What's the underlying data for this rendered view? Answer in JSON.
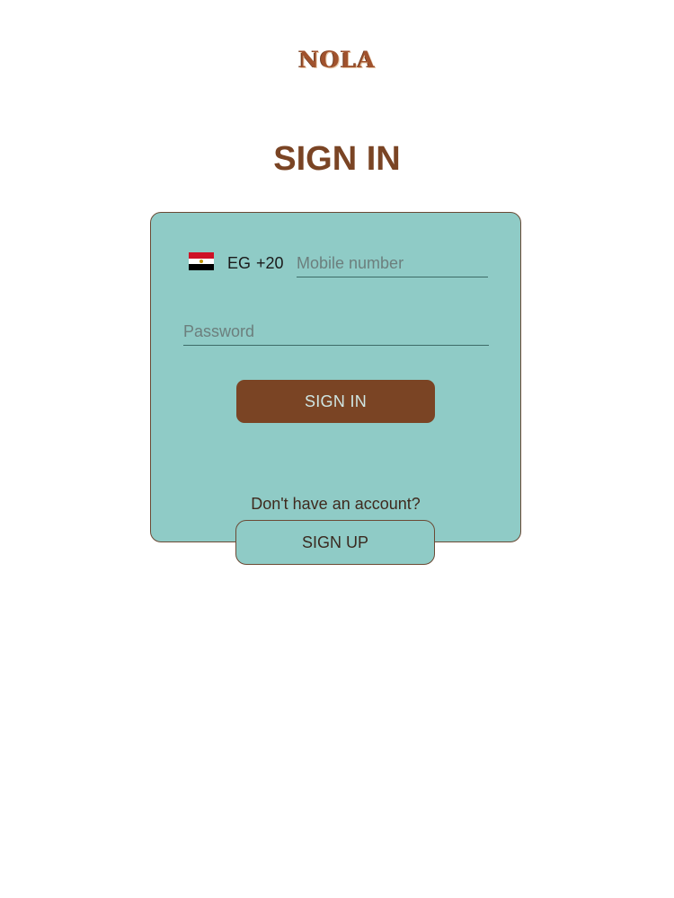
{
  "brand": {
    "logo_text": "NOLA"
  },
  "header": {
    "title": "SIGN IN"
  },
  "form": {
    "country": {
      "flag_icon": "egypt-flag-icon",
      "code": "EG",
      "dial_code": "+20"
    },
    "mobile": {
      "placeholder": "Mobile number",
      "value": ""
    },
    "password": {
      "placeholder": "Password",
      "value": ""
    },
    "signin_label": "SIGN IN",
    "no_account_text": "Don't have an account?",
    "signup_label": "SIGN UP"
  },
  "colors": {
    "brand_brown": "#7a4424",
    "card_teal": "#8fcbc6",
    "border_brown": "#6b4a35"
  }
}
